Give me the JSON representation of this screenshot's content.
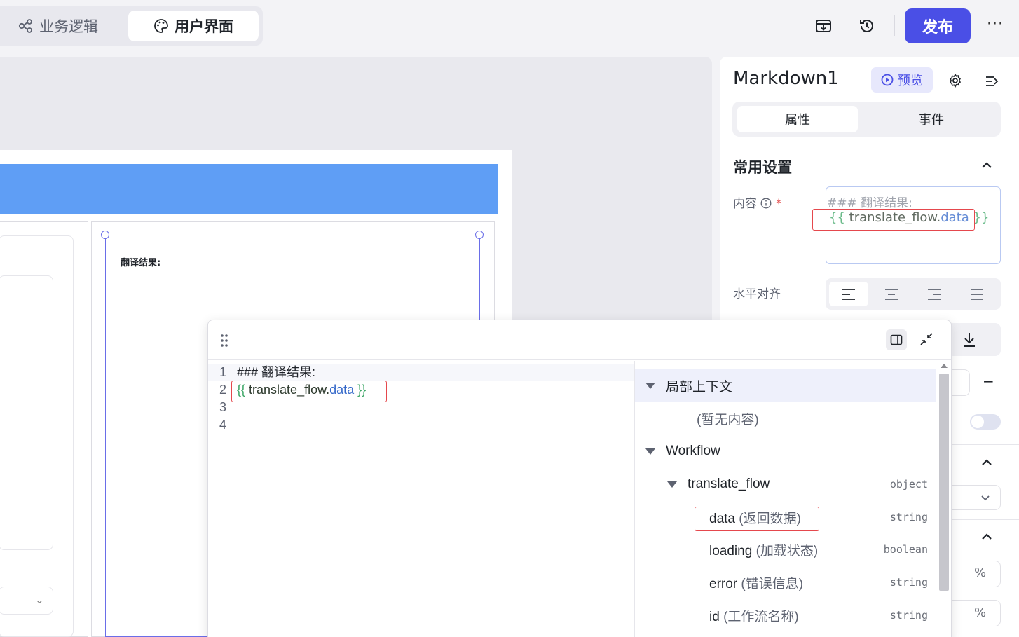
{
  "topbar": {
    "tabs": [
      {
        "label": "业务逻辑",
        "icon": "flow-nodes-icon"
      },
      {
        "label": "用户界面",
        "icon": "palette-icon"
      }
    ],
    "publish_label": "发布",
    "more_label": "···"
  },
  "canvas": {
    "markdown_preview_text": "翻译结果:"
  },
  "panel": {
    "component_name": "Markdown1",
    "preview_label": "预览",
    "tabs": [
      "属性",
      "事件"
    ],
    "section_common": "常用设置",
    "content_label": "内容",
    "content_value_line1": "### 翻译结果:",
    "content_value_line2": {
      "open": "{{ ",
      "ident": "translate_flow.",
      "prop": "data",
      "close": " }}"
    },
    "align_label": "水平对齐",
    "align_options": [
      "align-left",
      "align-center",
      "align-right",
      "align-justify"
    ],
    "align_selected": "align-left",
    "percent_unit": "%",
    "minus_label": "−"
  },
  "editor": {
    "lines": [
      {
        "no": "1",
        "text": "### 翻译结果:"
      },
      {
        "no": "2",
        "open": "{{ ",
        "ident": "translate_flow.",
        "prop": "data",
        "close": " }}"
      },
      {
        "no": "3",
        "text": ""
      },
      {
        "no": "4",
        "text": ""
      }
    ],
    "tree": {
      "local_context": "局部上下文",
      "empty": "(暂无内容)",
      "workflow": "Workflow",
      "flow_name": "translate_flow",
      "flow_type": "object",
      "fields": [
        {
          "name": "data",
          "note": "(返回数据)",
          "type": "string"
        },
        {
          "name": "loading",
          "note": "(加载状态)",
          "type": "boolean"
        },
        {
          "name": "error",
          "note": "(错误信息)",
          "type": "string"
        },
        {
          "name": "id",
          "note": "(工作流名称)",
          "type": "string"
        }
      ]
    }
  }
}
